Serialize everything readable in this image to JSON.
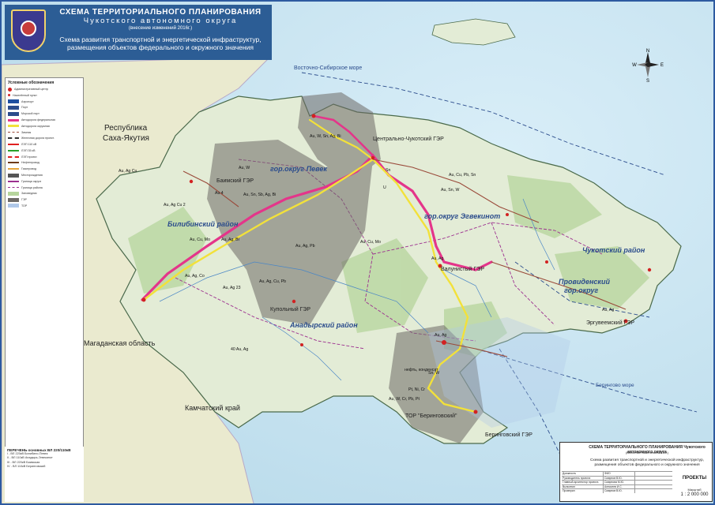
{
  "title_block": {
    "line1": "СХЕМА ТЕРРИТОРИАЛЬНОГО ПЛАНИРОВАНИЯ",
    "line2": "Чукотского автономного округа",
    "line3": "(внесение изменений 2016г.)",
    "line4": "Схема развития транспортной и энергетической инфраструктур,",
    "line5": "размещения объектов федерального и окружного значения"
  },
  "sea_labels": {
    "east_siberian": "Восточно-Сибирское море",
    "bering": "Берингово море"
  },
  "neighbor_regions": {
    "yakutia_1": "Республика",
    "yakutia_2": "Саха-Якутия",
    "magadan": "Магаданская область",
    "kamchatka": "Камчатский край"
  },
  "districts": {
    "pevek": "гор.округ Певек",
    "bilibino": "Билибинский район",
    "egvekinot": "гор.округ Эгвекинот",
    "anadyr": "Анадырский район",
    "chukotsky": "Чукотский район",
    "provideniya_1": "Провиденский",
    "provideniya_2": "гор.округ"
  },
  "power_plants": {
    "bainsky": "Баимский ГЭР",
    "central": "Центрально-Чукотский ГЭР",
    "valunisty": "Валунистый ГЭР",
    "kupolny": "Купольный ГЭР",
    "ergyveemsky": "Эргувеемский ГЭР",
    "beringovsky": "Беринговский ГЭР",
    "tor": "ТОР \"Беринговский\""
  },
  "minerals": {
    "m1": "Au, Ag Cu",
    "m2": "Au, Ag Cu 2",
    "m3": "Au, W",
    "m4": "Au, W, Sn, Ag, Bi",
    "m5": "Au 4",
    "m6": "Au, Sn, Sb, Ag, Bi",
    "m7": "Au, Cu, Mo",
    "m8": "Au, Ag, Bi",
    "m9": "Au, Ag, Pb",
    "m10": "Au, Ag, Cu, Pb",
    "m11": "Au, Ag, Co",
    "m12": "Au, Ag 23",
    "m13": "Au, Cu, Mo",
    "m14": "Au, Ag",
    "m15": "Au, Cu, Pb, Sn",
    "m16": "Au, Sn, W",
    "m17": "Sn",
    "m18": "U",
    "m19": "Au, Ag",
    "m20": "нефть, конденсат",
    "m21": "Pt, Ni, Cr",
    "m22": "Au, W, Cr, Pb, Pt",
    "m23": "Sn, W",
    "m24": "Au, Ag",
    "m25": "40 Au, Ag"
  },
  "legend": {
    "title": "Условные обозначения",
    "items": [
      "Административный центр",
      "Населённый пункт",
      "Аэропорт",
      "Порт",
      "Морской порт",
      "Автодорога федеральная",
      "Автодорога окружная",
      "Зимник",
      "Железная дорога проект.",
      "ЛЭП 110 кВ",
      "ЛЭП 35 кВ",
      "ЛЭП проект.",
      "Нефтепровод",
      "Газопровод",
      "Месторождения",
      "Граница округа",
      "Граница района",
      "Заповедник",
      "ГЭР",
      "ТОР"
    ]
  },
  "perechen": {
    "title": "ПЕРЕЧЕНЬ основных ВЛ 220/110кВ",
    "rows": [
      "I - ВЛ 220кВ Билибино-Певек",
      "II - ВЛ 110кВ Анадырь-Эгвекинот",
      "III - ВЛ 220кВ Баимская",
      "IV - ВЛ 110кВ Беринговский"
    ]
  },
  "stamp": {
    "title": "СХЕМА ТЕРРИТОРИАЛЬНОГО ПЛАНИРОВАНИЯ Чукотского автономного округа",
    "subtitle": "(Внесение изменений 2016г.)",
    "desc1": "Схема развития транспортной и энергетической инфраструктур,",
    "desc2": "размещения объектов федерального и окружного значения",
    "rows": [
      {
        "role": "Должность",
        "name": "ФИО"
      },
      {
        "role": "Руководитель проекта",
        "name": "Смирнов В.Ю."
      },
      {
        "role": "Главный архитектор проекта",
        "name": "Смирнова М.Ю."
      },
      {
        "role": "Выполнил",
        "name": "Алексеев И.С."
      },
      {
        "role": "Проверил",
        "name": "Смирнов В.Ю."
      }
    ],
    "org": "ПРОЕКТЫ",
    "scale_label": "Масштаб",
    "scale": "1 : 2 000 000"
  },
  "compass": {
    "n": "N",
    "s": "S",
    "w": "W",
    "e": "E"
  },
  "colors": {
    "sea": "#c9e4f2",
    "land": "#e3ecd6",
    "forest": "#9fc987",
    "federal_road": "#e4358a",
    "regional_road": "#f2e13a",
    "tor_zone": "#6e6a66",
    "boundary": "#9c2f8f"
  }
}
